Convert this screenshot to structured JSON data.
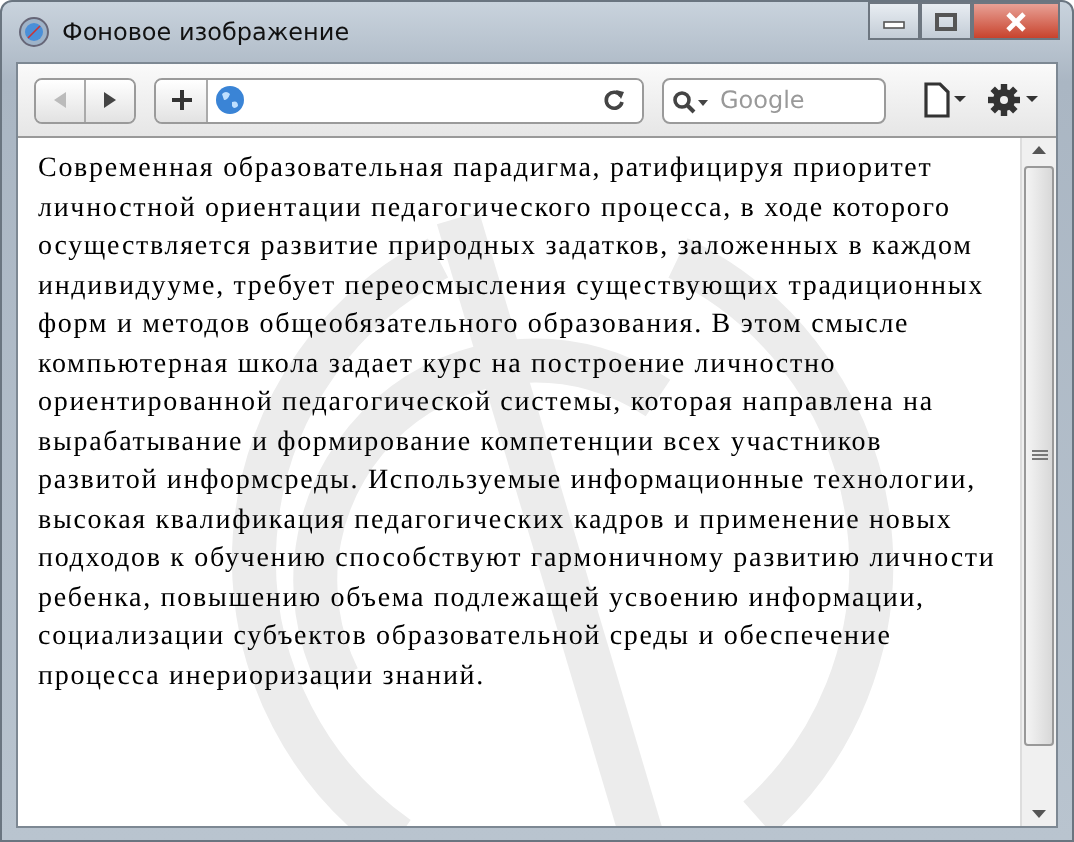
{
  "window": {
    "title": "Фоновое изображение"
  },
  "toolbar": {
    "search": {
      "placeholder": "Google"
    }
  },
  "page": {
    "paragraph_lines": [
      "Современная образовательная парадигма, ратифицируя приоритет",
      "личностной ориентации педагогического процесса, в ходе которого",
      "осуществляется развитие природных задатков, заложенных в каждом",
      "индивидууме, требует переосмысления существующих традиционных",
      "форм и методов общеобязательного образования. В этом смысле",
      "компьютерная школа задает курс на построение личностно",
      "ориентированной педагогической системы, которая направлена на",
      "вырабатывание и формирование компетенции всех участников",
      "развитой информсреды. Используемые информационные технологии,",
      "высокая квалификация педагогических кадров и применение новых",
      "подходов к обучению способствуют гармоничному развитию личности",
      "ребенка, повышению объема подлежащей усвоению информации,",
      "социализации субъектов образовательной среды и обеспечение",
      "процесса инериоризации знаний."
    ]
  }
}
